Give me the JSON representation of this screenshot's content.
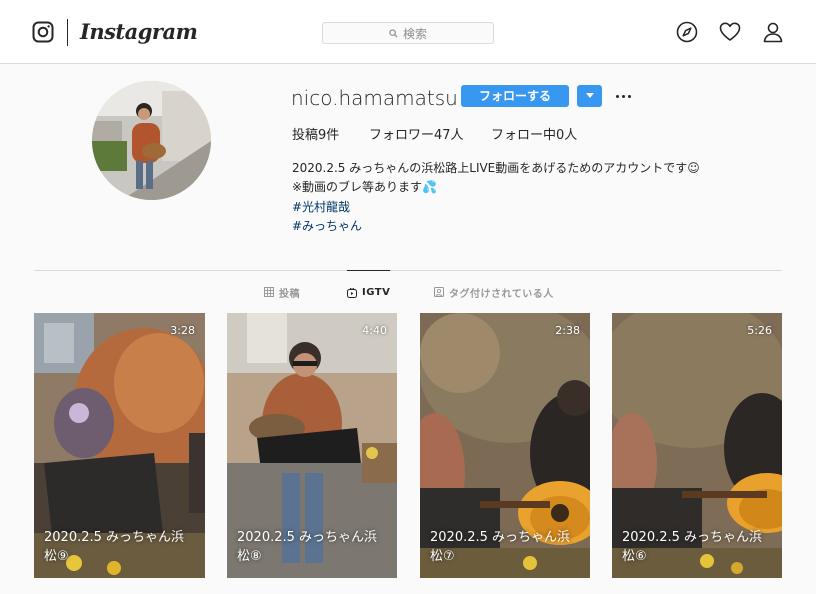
{
  "header": {
    "wordmark": "Instagram",
    "search_placeholder": "検索",
    "icons": [
      "instagram-glyph-icon",
      "search-icon",
      "explore-compass-icon",
      "heart-icon",
      "profile-icon"
    ]
  },
  "profile": {
    "username": "nico.hamamatsu",
    "follow_label": "フォローする",
    "stats": {
      "posts": "投稿9件",
      "followers": "フォロワー47人",
      "following": "フォロー中0人"
    },
    "bio": {
      "line1": "2020.2.5 みっちゃんの浜松路上LIVE動画をあげるためのアカウントです☺",
      "line2": "※動画のブレ等あります💦",
      "tag1": "#光村龍哉",
      "tag2": "#みっちゃん"
    }
  },
  "tabs": [
    {
      "label": "投稿",
      "icon": "grid-icon",
      "active": false
    },
    {
      "label": "IGTV",
      "icon": "igtv-icon",
      "active": true
    },
    {
      "label": "タグ付けされている人",
      "icon": "tagged-icon",
      "active": false
    }
  ],
  "videos": [
    {
      "duration": "3:28",
      "title": "2020.2.5 みっちゃん浜松⑨"
    },
    {
      "duration": "4:40",
      "title": "2020.2.5 みっちゃん浜松⑧"
    },
    {
      "duration": "2:38",
      "title": "2020.2.5 みっちゃん浜松⑦"
    },
    {
      "duration": "5:26",
      "title": "2020.2.5 みっちゃん浜松⑥"
    }
  ],
  "colors": {
    "accent": "#3897f0",
    "link": "#003569",
    "text": "#262626",
    "muted": "#8e8e8e",
    "border": "#dbdbdb",
    "background": "#fafafa"
  }
}
